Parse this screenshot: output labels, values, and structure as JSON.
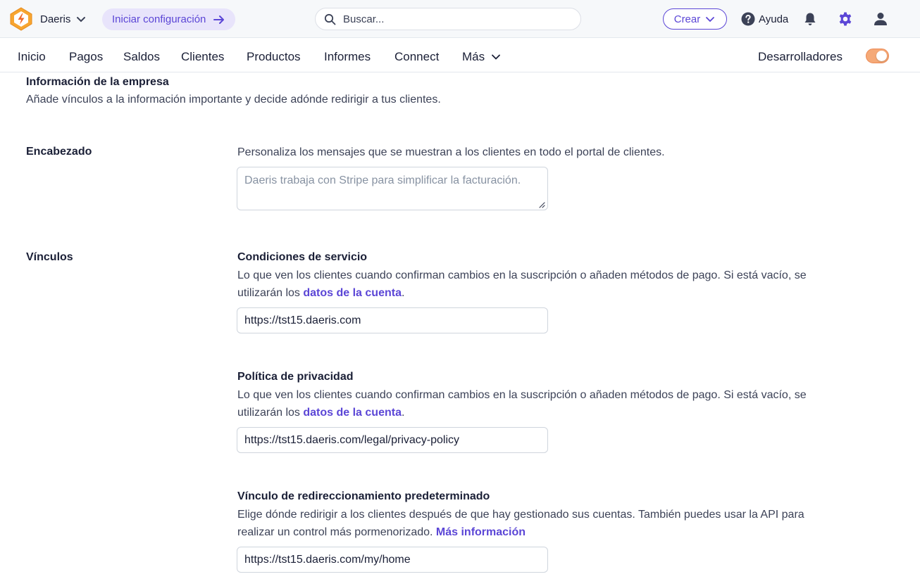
{
  "topbar": {
    "account_name": "Daeris",
    "setup_label": "Iniciar configuración",
    "search_placeholder": "Buscar...",
    "create_label": "Crear",
    "help_label": "Ayuda"
  },
  "nav": {
    "items": [
      "Inicio",
      "Pagos",
      "Saldos",
      "Clientes",
      "Productos",
      "Informes",
      "Connect",
      "Más"
    ],
    "developers_label": "Desarrolladores",
    "developers_toggle_on": true
  },
  "section": {
    "title": "Información de la empresa",
    "description": "Añade vínculos a la información importante y decide adónde redirigir a tus clientes."
  },
  "header_row": {
    "label": "Encabezado",
    "description": "Personaliza los mensajes que se muestran a los clientes en todo el portal de clientes.",
    "textarea_placeholder": "Daeris trabaja con Stripe para simplificar la facturación."
  },
  "links_row": {
    "label": "Vínculos",
    "terms": {
      "title": "Condiciones de servicio",
      "description_line1": "Lo que ven los clientes cuando confirman cambios en la suscripción o añaden métodos de pago. Si está vacío, se",
      "description_prefix": "utilizarán los ",
      "link": "datos de la cuenta",
      "description_suffix": ".",
      "value": "https://tst15.daeris.com"
    },
    "privacy": {
      "title": "Política de privacidad",
      "description_line1": "Lo que ven los clientes cuando confirman cambios en la suscripción o añaden métodos de pago. Si está vacío, se",
      "description_prefix": "utilizarán los ",
      "link": "datos de la cuenta",
      "description_suffix": ".",
      "value": "https://tst15.daeris.com/legal/privacy-policy"
    },
    "redirect": {
      "title": "Vínculo de redireccionamiento predeterminado",
      "description_line1": "Elige dónde redirigir a los clientes después de que hay gestionado sus cuentas. También puedes usar la API para",
      "description_prefix": "realizar un control más pormenorizado. ",
      "link": "Más información",
      "value": "https://tst15.daeris.com/my/home"
    }
  },
  "colors": {
    "accent": "#5b46d6",
    "setup_pill_bg": "#e8e4fb",
    "toggle_on": "#f5a977",
    "logo_orange": "#f7a530"
  }
}
